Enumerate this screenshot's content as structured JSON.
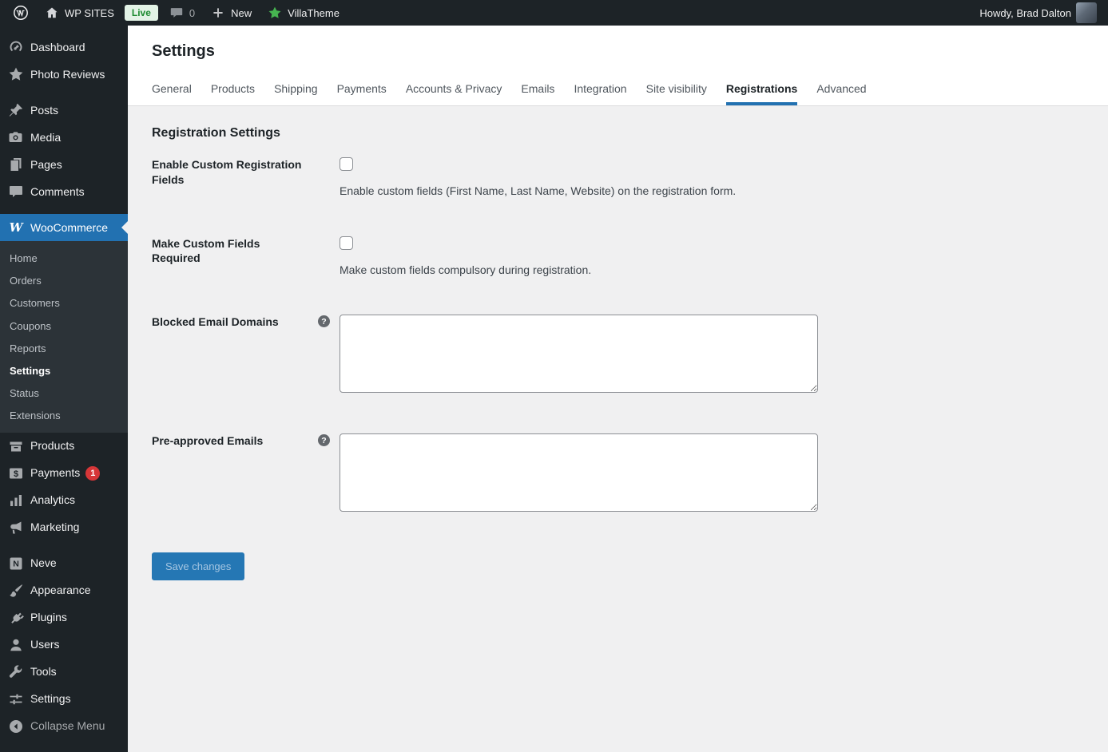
{
  "admin_bar": {
    "site_name": "WP SITES",
    "live_badge": "Live",
    "comment_count": "0",
    "new_label": "New",
    "theme_name": "VillaTheme",
    "howdy": "Howdy, Brad Dalton"
  },
  "sidebar": {
    "items": [
      {
        "label": "Dashboard"
      },
      {
        "label": "Photo Reviews"
      },
      {
        "label": "Posts"
      },
      {
        "label": "Media"
      },
      {
        "label": "Pages"
      },
      {
        "label": "Comments"
      },
      {
        "label": "WooCommerce"
      },
      {
        "label": "Products"
      },
      {
        "label": "Payments"
      },
      {
        "label": "Analytics"
      },
      {
        "label": "Marketing"
      },
      {
        "label": "Neve"
      },
      {
        "label": "Appearance"
      },
      {
        "label": "Plugins"
      },
      {
        "label": "Users"
      },
      {
        "label": "Tools"
      },
      {
        "label": "Settings"
      },
      {
        "label": "Collapse Menu"
      }
    ],
    "payments_badge": "1",
    "woocommerce_submenu": [
      "Home",
      "Orders",
      "Customers",
      "Coupons",
      "Reports",
      "Settings",
      "Status",
      "Extensions"
    ],
    "current_submenu_item": "Settings"
  },
  "main": {
    "page_title": "Settings",
    "tabs": [
      "General",
      "Products",
      "Shipping",
      "Payments",
      "Accounts & Privacy",
      "Emails",
      "Integration",
      "Site visibility",
      "Registrations",
      "Advanced"
    ],
    "active_tab": "Registrations",
    "section_title": "Registration Settings",
    "fields": {
      "enable_custom": {
        "label": "Enable Custom Registration Fields",
        "description": "Enable custom fields (First Name, Last Name, Website) on the registration form.",
        "checked": false
      },
      "required_custom": {
        "label": "Make Custom Fields Required",
        "description": "Make custom fields compulsory during registration.",
        "checked": false
      },
      "blocked_domains": {
        "label": "Blocked Email Domains",
        "value": ""
      },
      "preapproved_emails": {
        "label": "Pre-approved Emails",
        "value": ""
      }
    },
    "save_button": "Save changes"
  },
  "colors": {
    "accent_blue": "#2271b1",
    "sidebar_bg": "#1d2327",
    "submenu_bg": "#2c3338",
    "content_bg": "#f0f0f1",
    "badge_red": "#d63638",
    "live_green": "#1b8a2f",
    "star_green": "#46b450"
  }
}
